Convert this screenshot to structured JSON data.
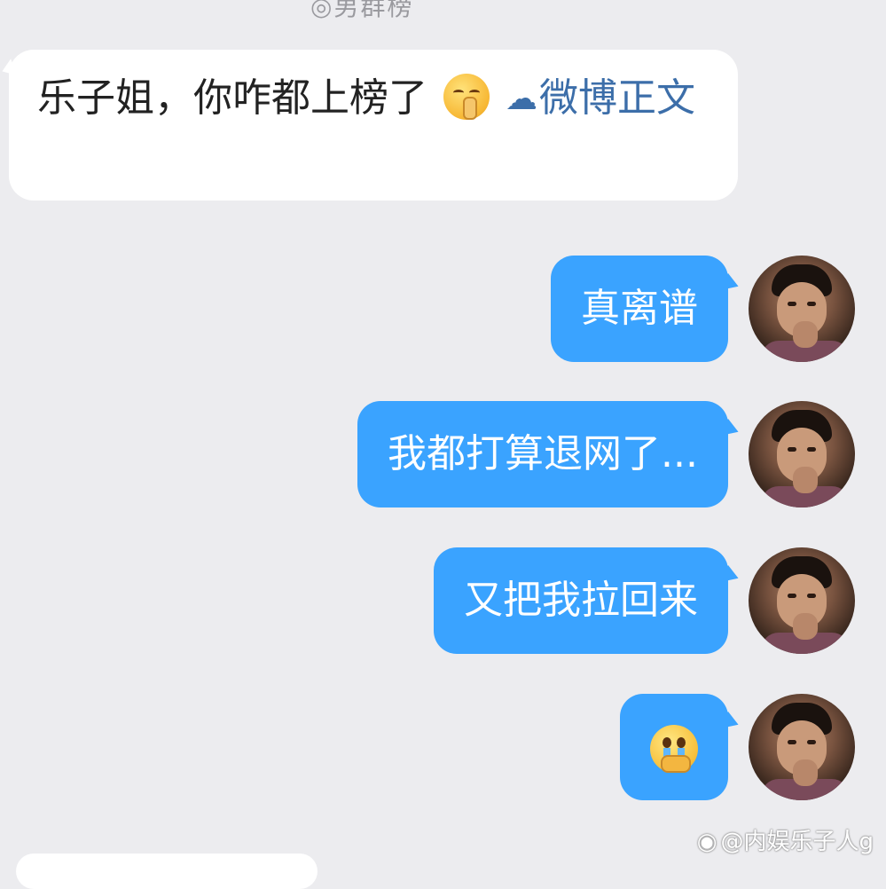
{
  "header": {
    "cut_text": "◎男群榜"
  },
  "incoming_message": {
    "text": "乐子姐，你咋都上榜了",
    "emoji": "shush-face-icon",
    "link_text": "微博正文"
  },
  "outgoing_messages": [
    {
      "text": "真离谱"
    },
    {
      "text": "我都打算退网了..."
    },
    {
      "text": "又把我拉回来"
    },
    {
      "text": "",
      "emoji": "crying-face-hands-icon"
    }
  ],
  "watermark": {
    "text": "@内娱乐子人g"
  },
  "colors": {
    "background": "#ececef",
    "outgoing_bubble": "#3aa3ff",
    "link": "#3c6ea9"
  }
}
